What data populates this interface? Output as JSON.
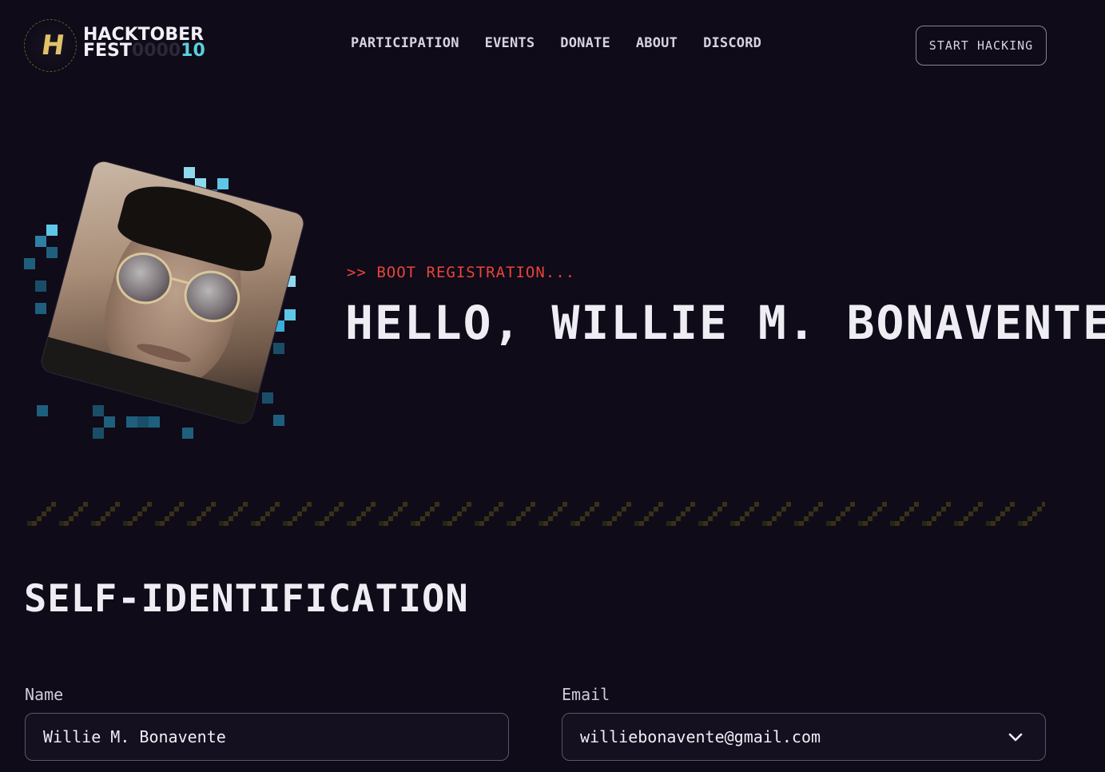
{
  "header": {
    "logo": {
      "line1": "HACKTOBER",
      "line2_main": "FEST",
      "line2_dim": "0000",
      "line2_num": "10",
      "icon": "hacktoberfest-badge-icon"
    },
    "nav": [
      {
        "label": "PARTICIPATION"
      },
      {
        "label": "EVENTS"
      },
      {
        "label": "DONATE"
      },
      {
        "label": "ABOUT"
      },
      {
        "label": "DISCORD"
      }
    ],
    "cta_label": "START HACKING"
  },
  "hero": {
    "boot_text": ">> BOOT REGISTRATION...",
    "greeting": "HELLO, WILLIE M. BONAVENTE",
    "avatar_alt": "profile-photo"
  },
  "section": {
    "title": "SELF-IDENTIFICATION",
    "name_label": "Name",
    "name_value": "Willie M. Bonavente",
    "email_label": "Email",
    "email_value": "williebonavente@gmail.com",
    "email_icon": "chevron-down-icon"
  },
  "colors": {
    "background": "#0f0b18",
    "accent_red": "#e8443a",
    "accent_cyan": "#5ad0e0",
    "divider": "#3a3018"
  }
}
